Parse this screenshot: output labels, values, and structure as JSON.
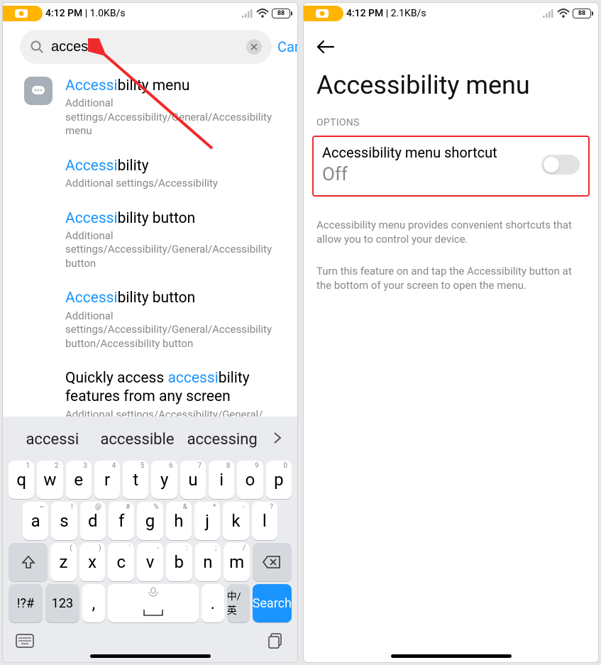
{
  "left": {
    "status": {
      "time": "4:12 PM",
      "net": "1.0KB/s",
      "battery": "88"
    },
    "search": {
      "query": "accessi",
      "cancel": "Cancel"
    },
    "results": [
      {
        "title_pre": "Accessi",
        "title_post": "bility menu",
        "path": "Additional settings/Accessibility/General/Accessibility menu",
        "has_icon": true
      },
      {
        "title_pre": "Accessi",
        "title_post": "bility",
        "path": "Additional settings/Accessibility"
      },
      {
        "title_pre": "Accessi",
        "title_post": "bility button",
        "path": "Additional settings/Accessibility/General/Accessibility button"
      },
      {
        "title_pre": "Accessi",
        "title_post": "bility button",
        "path": "Additional settings/Accessibility/General/Accessibility button/Accessibility button"
      },
      {
        "title_pre_plain": "Quickly access ",
        "title_match": "accessi",
        "title_post_plain": "bility features from any screen",
        "path": "Additional settings/Accessibility/General/"
      }
    ],
    "suggestions": [
      "accessi",
      "accessible",
      "accessing"
    ],
    "keyboard": {
      "row1": [
        {
          "c": "q",
          "s": "1"
        },
        {
          "c": "w",
          "s": "2"
        },
        {
          "c": "e",
          "s": "3"
        },
        {
          "c": "r",
          "s": "4"
        },
        {
          "c": "t",
          "s": "5"
        },
        {
          "c": "y",
          "s": "6"
        },
        {
          "c": "u",
          "s": "7"
        },
        {
          "c": "i",
          "s": "8"
        },
        {
          "c": "o",
          "s": "9"
        },
        {
          "c": "p",
          "s": "0"
        }
      ],
      "row2": [
        {
          "c": "a",
          "s": "~"
        },
        {
          "c": "s",
          "s": "!"
        },
        {
          "c": "d",
          "s": "@"
        },
        {
          "c": "f",
          "s": "#"
        },
        {
          "c": "g",
          "s": "%"
        },
        {
          "c": "h",
          "s": "&"
        },
        {
          "c": "j",
          "s": "*"
        },
        {
          "c": "k",
          "s": "-"
        },
        {
          "c": "l",
          "s": "?"
        }
      ],
      "row3": [
        {
          "c": "z",
          "s": "("
        },
        {
          "c": "x",
          "s": ")"
        },
        {
          "c": "c",
          "s": "'"
        },
        {
          "c": "v",
          "s": "-"
        },
        {
          "c": "b",
          "s": ":"
        },
        {
          "c": "n",
          "s": ";"
        },
        {
          "c": "m",
          "s": "/"
        }
      ],
      "symbols": "!?#",
      "numbers": "123",
      "comma": ",",
      "period": ".",
      "lang": "中/英",
      "search": "Search"
    }
  },
  "right": {
    "status": {
      "time": "4:12 PM",
      "net": "2.1KB/s",
      "battery": "88"
    },
    "title": "Accessibility menu",
    "section": "OPTIONS",
    "setting": {
      "title": "Accessibility menu shortcut",
      "state": "Off"
    },
    "help1": "Accessibility menu provides convenient shortcuts that allow you to control your device.",
    "help2": "Turn this feature on and tap the Accessibility button at the bottom of your screen to open the menu."
  }
}
